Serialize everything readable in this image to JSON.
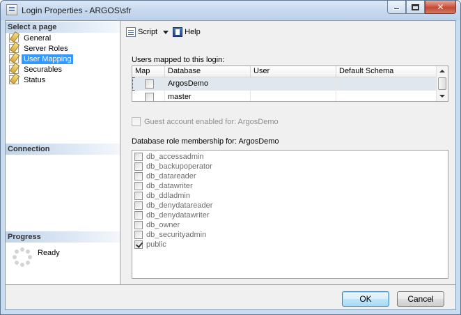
{
  "window": {
    "title": "Login Properties - ARGOS\\sfr"
  },
  "left_pane": {
    "select_page_header": "Select a page",
    "pages": [
      {
        "label": "General",
        "selected": false
      },
      {
        "label": "Server Roles",
        "selected": false
      },
      {
        "label": "User Mapping",
        "selected": true
      },
      {
        "label": "Securables",
        "selected": false
      },
      {
        "label": "Status",
        "selected": false
      }
    ],
    "connection_header": "Connection",
    "progress_header": "Progress",
    "progress_status": "Ready"
  },
  "toolbar": {
    "script_label": "Script",
    "help_label": "Help"
  },
  "user_mapping": {
    "users_label": "Users mapped to this login:",
    "columns": [
      "Map",
      "Database",
      "User",
      "Default Schema"
    ],
    "rows": [
      {
        "map": false,
        "database": "ArgosDemo",
        "user": "",
        "schema": ""
      },
      {
        "map": false,
        "database": "master",
        "user": "",
        "schema": ""
      }
    ],
    "guest_label": "Guest account enabled for: ArgosDemo",
    "role_label": "Database role membership for: ArgosDemo",
    "roles": [
      {
        "name": "db_accessadmin",
        "checked": false
      },
      {
        "name": "db_backupoperator",
        "checked": false
      },
      {
        "name": "db_datareader",
        "checked": false
      },
      {
        "name": "db_datawriter",
        "checked": false
      },
      {
        "name": "db_ddladmin",
        "checked": false
      },
      {
        "name": "db_denydatareader",
        "checked": false
      },
      {
        "name": "db_denydatawriter",
        "checked": false
      },
      {
        "name": "db_owner",
        "checked": false
      },
      {
        "name": "db_securityadmin",
        "checked": false
      },
      {
        "name": "public",
        "checked": true
      }
    ]
  },
  "buttons": {
    "ok": "OK",
    "cancel": "Cancel"
  }
}
